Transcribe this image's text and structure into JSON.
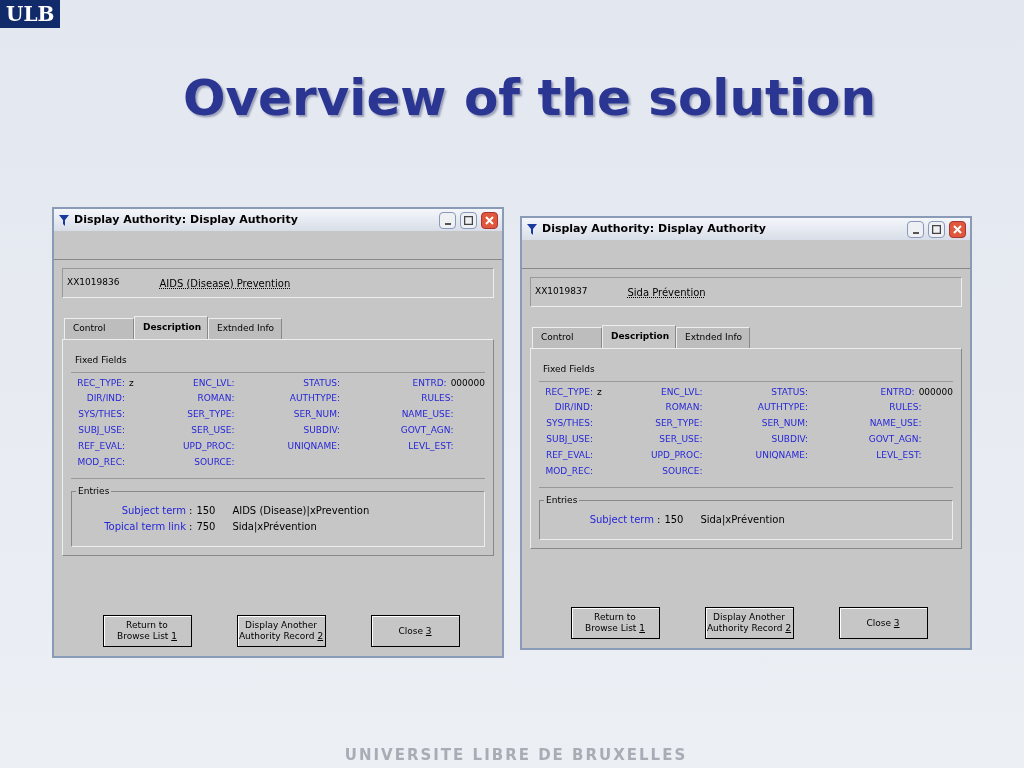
{
  "slide": {
    "logo": "ULB",
    "title": "Overview of the solution",
    "footer": "UNIVERSITE LIBRE DE BRUXELLES"
  },
  "windows": [
    {
      "title": "Display Authority: Display Authority",
      "record_id": "XX1019836",
      "heading": "AIDS (Disease) Prevention",
      "tabs": [
        {
          "label": "Control",
          "selected": false
        },
        {
          "label": "Description",
          "selected": true
        },
        {
          "label": "Extnded Info",
          "selected": false
        }
      ],
      "section": "Fixed Fields",
      "fields": [
        {
          "label": "REC_TYPE:",
          "value": "z"
        },
        {
          "label": "ENC_LVL:"
        },
        {
          "label": "STATUS:"
        },
        {
          "label": "ENTRD:",
          "value": "000000"
        },
        {
          "label": "DIR/IND:"
        },
        {
          "label": "ROMAN:"
        },
        {
          "label": "AUTHTYPE:"
        },
        {
          "label": "RULES:"
        },
        {
          "label": "SYS/THES:"
        },
        {
          "label": "SER_TYPE:"
        },
        {
          "label": "SER_NUM:"
        },
        {
          "label": "NAME_USE:"
        },
        {
          "label": "SUBJ_USE:"
        },
        {
          "label": "SER_USE:"
        },
        {
          "label": "SUBDIV:"
        },
        {
          "label": "GOVT_AGN:"
        },
        {
          "label": "REF_EVAL:"
        },
        {
          "label": "UPD_PROC:"
        },
        {
          "label": "UNIQNAME:"
        },
        {
          "label": "LEVL_EST:"
        },
        {
          "label": "MOD_REC:"
        },
        {
          "label": "SOURCE:"
        }
      ],
      "entries_title": "Entries",
      "entries": [
        {
          "label": "Subject term",
          "colon": ":",
          "tag": "150",
          "text": "AIDS (Disease)|xPrevention"
        },
        {
          "label": "Topical term link",
          "colon": ":",
          "tag": "750",
          "text": "Sida|xPrévention"
        }
      ],
      "buttons": [
        {
          "lines": [
            "Return to",
            "Browse List"
          ],
          "key": "1"
        },
        {
          "lines": [
            "Display Another",
            "Authority Record"
          ],
          "key": "2"
        },
        {
          "lines": [
            "Close"
          ],
          "key": "3"
        }
      ]
    },
    {
      "title": "Display Authority: Display Authority",
      "record_id": "XX1019837",
      "heading": "Sida Prévention",
      "tabs": [
        {
          "label": "Control",
          "selected": false
        },
        {
          "label": "Description",
          "selected": true
        },
        {
          "label": "Extnded Info",
          "selected": false
        }
      ],
      "section": "Fixed Fields",
      "fields": [
        {
          "label": "REC_TYPE:",
          "value": "z"
        },
        {
          "label": "ENC_LVL:"
        },
        {
          "label": "STATUS:"
        },
        {
          "label": "ENTRD:",
          "value": "000000"
        },
        {
          "label": "DIR/IND:"
        },
        {
          "label": "ROMAN:"
        },
        {
          "label": "AUTHTYPE:"
        },
        {
          "label": "RULES:"
        },
        {
          "label": "SYS/THES:"
        },
        {
          "label": "SER_TYPE:"
        },
        {
          "label": "SER_NUM:"
        },
        {
          "label": "NAME_USE:"
        },
        {
          "label": "SUBJ_USE:"
        },
        {
          "label": "SER_USE:"
        },
        {
          "label": "SUBDIV:"
        },
        {
          "label": "GOVT_AGN:"
        },
        {
          "label": "REF_EVAL:"
        },
        {
          "label": "UPD_PROC:"
        },
        {
          "label": "UNIQNAME:"
        },
        {
          "label": "LEVL_EST:"
        },
        {
          "label": "MOD_REC:"
        },
        {
          "label": "SOURCE:"
        }
      ],
      "entries_title": "Entries",
      "entries": [
        {
          "label": "Subject term",
          "colon": ":",
          "tag": "150",
          "text": "Sida|xPrévention"
        }
      ],
      "buttons": [
        {
          "lines": [
            "Return to",
            "Browse List"
          ],
          "key": "1"
        },
        {
          "lines": [
            "Display Another",
            "Authority Record"
          ],
          "key": "2"
        },
        {
          "lines": [
            "Close"
          ],
          "key": "3"
        }
      ]
    }
  ]
}
